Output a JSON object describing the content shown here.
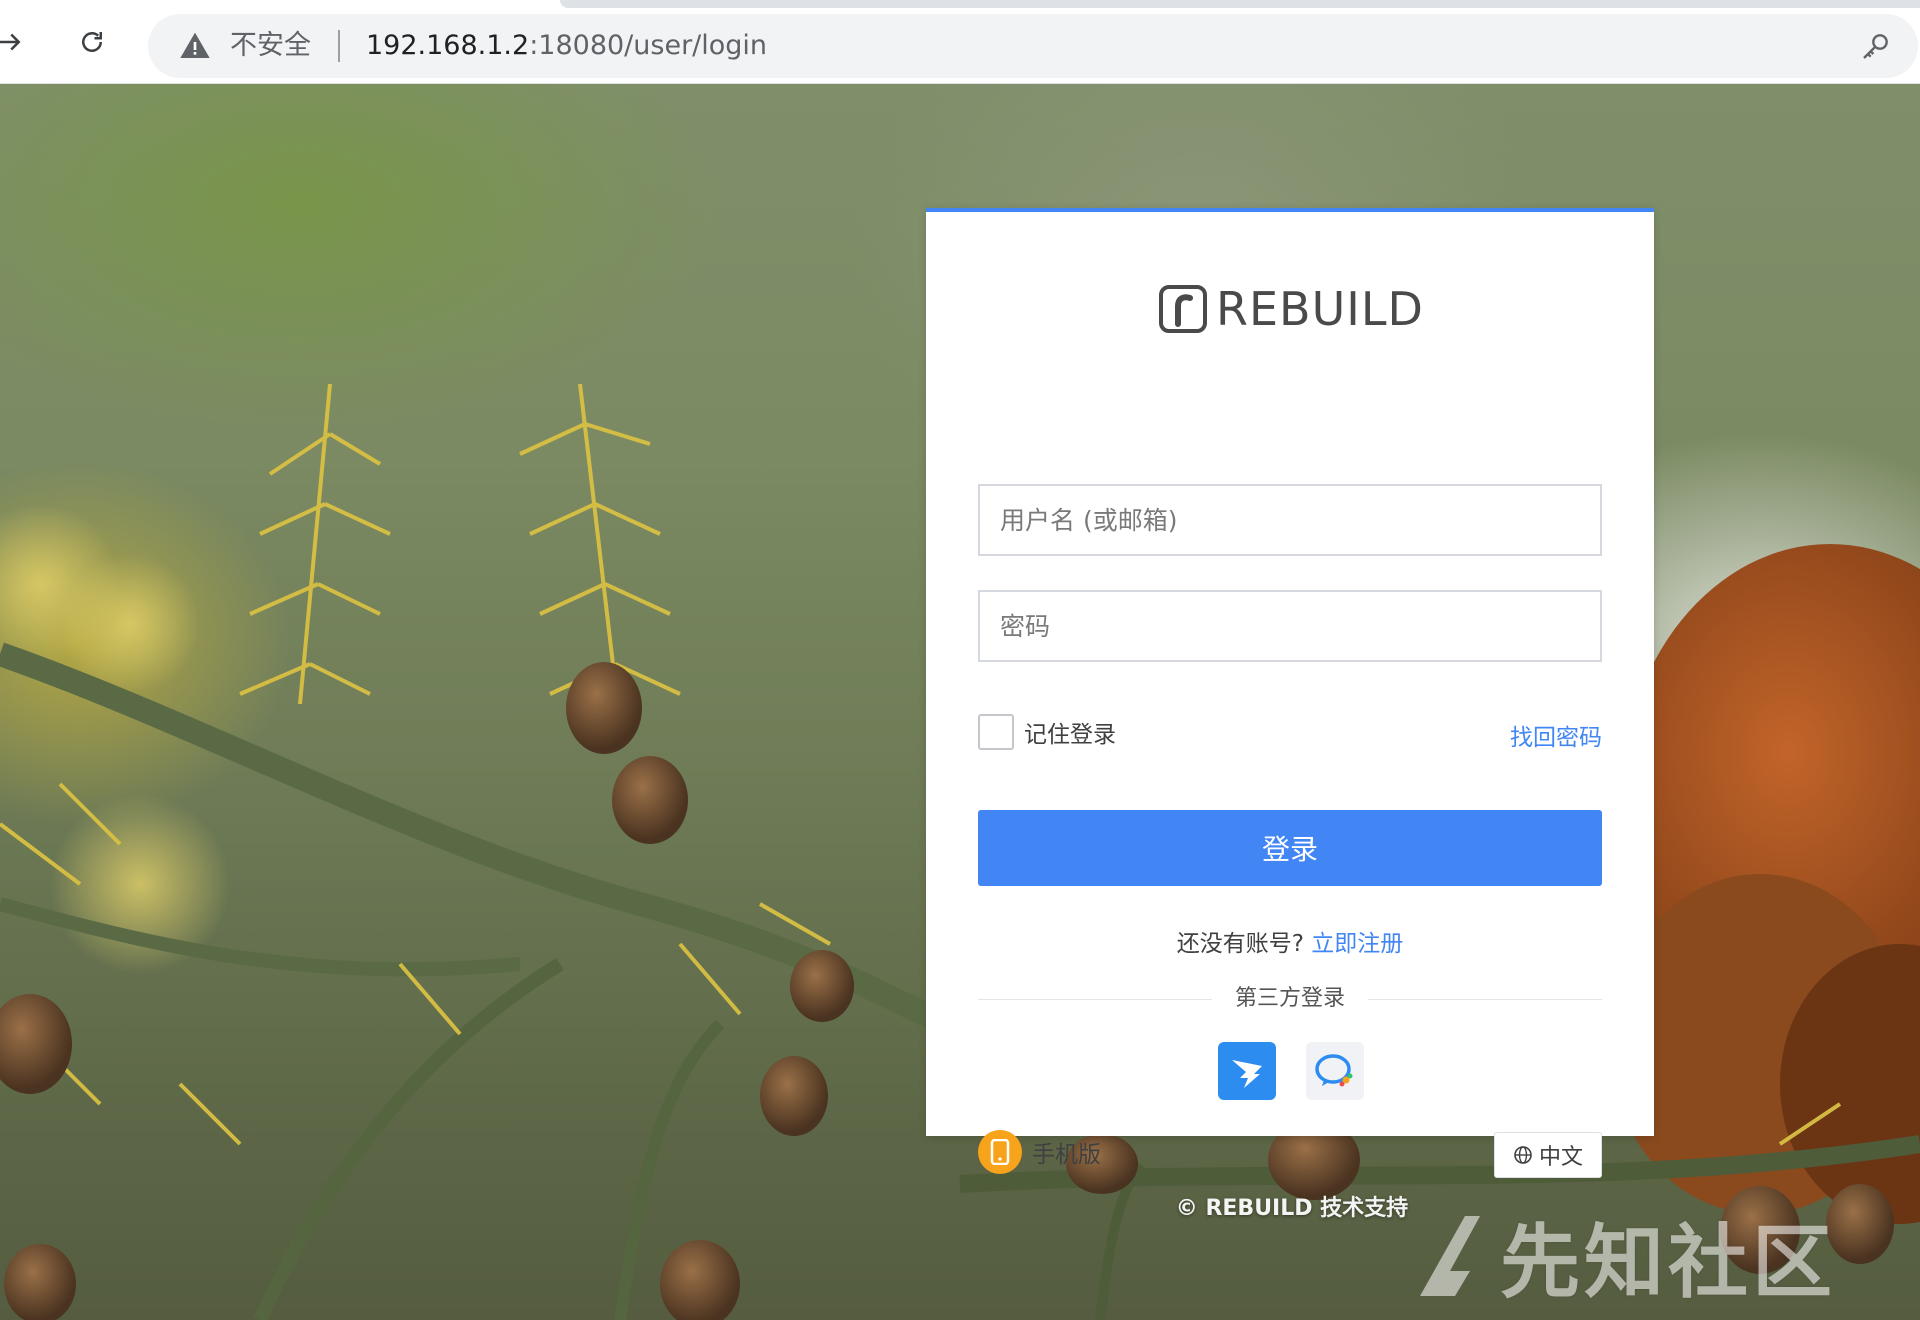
{
  "browser": {
    "insecure_label": "不安全",
    "url_host": "192.168.1.2",
    "url_rest": ":18080/user/login",
    "icons": {
      "forward": "forward-arrow-icon",
      "reload": "reload-icon",
      "warning": "warning-triangle-icon",
      "key": "key-icon"
    }
  },
  "login": {
    "brand": "REBUILD",
    "username_placeholder": "用户名 (或邮箱)",
    "password_placeholder": "密码",
    "remember_label": "记住登录",
    "forgot_label": "找回密码",
    "submit_label": "登录",
    "no_account_text": "还没有账号?",
    "signup_label": "立即注册",
    "third_party_label": "第三方登录",
    "sso": [
      "dingtalk-icon",
      "wechat-work-icon"
    ],
    "mobile_label": "手机版",
    "language_label": "中文",
    "accent_color": "#4285f4"
  },
  "footer": {
    "copyright": "© REBUILD 技术支持",
    "watermark": "先知社区"
  }
}
